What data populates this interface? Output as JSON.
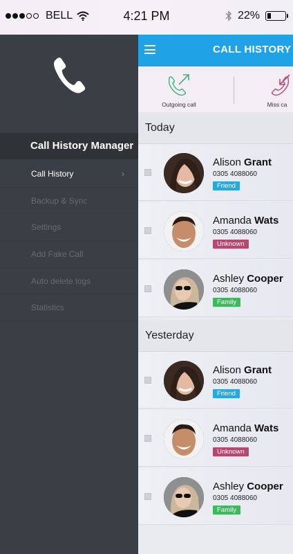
{
  "status_bar": {
    "carrier": "BELL",
    "time": "4:21 PM",
    "battery": "22%",
    "battery_level": 0.22,
    "signal_dots_filled": 3,
    "signal_dots_total": 5
  },
  "sidebar": {
    "title": "Call History Manager",
    "items": [
      {
        "label": "Call History",
        "active": true
      },
      {
        "label": "Backup & Sync",
        "active": false
      },
      {
        "label": "Settings",
        "active": false
      },
      {
        "label": "Add Fake Call",
        "active": false
      },
      {
        "label": "Auto delete logs",
        "active": false
      },
      {
        "label": "Statistics",
        "active": false
      }
    ],
    "chevron": "›"
  },
  "header": {
    "title": "CALL HISTORY"
  },
  "filters": [
    {
      "label": "Outgoing call",
      "icon": "outgoing-call-icon",
      "color": "#3fb27f"
    },
    {
      "label": "Miss ca",
      "icon": "missed-call-icon",
      "color": "#c0457a"
    }
  ],
  "sections": [
    {
      "title": "Today",
      "calls": [
        {
          "first": "Alison",
          "last": "Grant",
          "phone": "0305 4088060",
          "tag": "Friend",
          "tag_color": "#29a8e0"
        },
        {
          "first": "Amanda",
          "last": "Wats",
          "phone": "0305 4088060",
          "tag": "Unknown",
          "tag_color": "#b8476f"
        },
        {
          "first": "Ashley",
          "last": "Cooper",
          "phone": "0305 4088060",
          "tag": "Family",
          "tag_color": "#3dba5e"
        }
      ]
    },
    {
      "title": "Yesterday",
      "calls": [
        {
          "first": "Alison",
          "last": "Grant",
          "phone": "0305 4088060",
          "tag": "Friend",
          "tag_color": "#29a8e0"
        },
        {
          "first": "Amanda",
          "last": "Wats",
          "phone": "0305 4088060",
          "tag": "Unknown",
          "tag_color": "#b8476f"
        },
        {
          "first": "Ashley",
          "last": "Cooper",
          "phone": "0305 4088060",
          "tag": "Family",
          "tag_color": "#3dba5e"
        }
      ]
    }
  ],
  "colors": {
    "accent": "#1fa3e6",
    "sidebar_bg": "#3a3f45"
  }
}
